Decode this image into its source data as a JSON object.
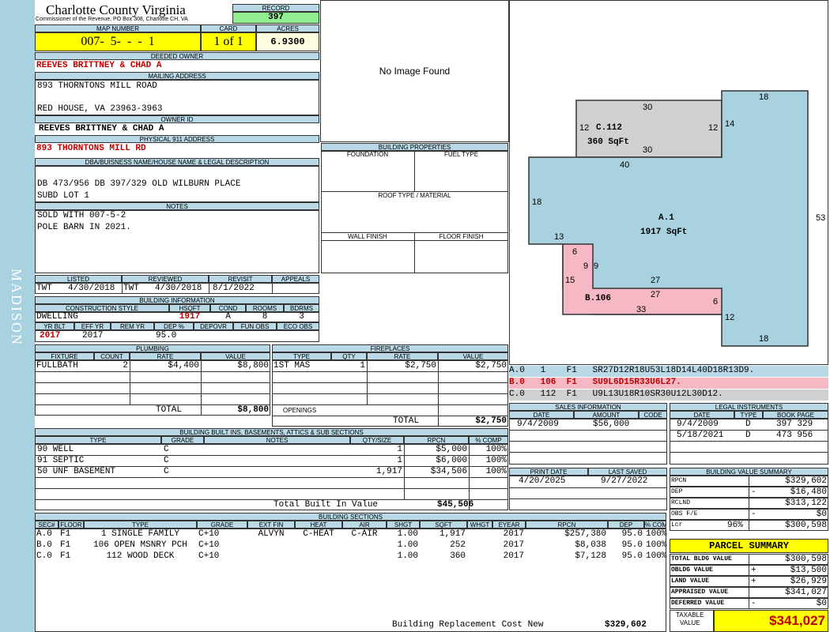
{
  "sidebar_label": "MADISON",
  "header": {
    "county": "Charlotte County Virginia",
    "subtitle": "Commissioner of the Revenue, PO Box 308, Charlotte CH, VA",
    "record_label": "RECORD",
    "record": "397",
    "map_label": "MAP NUMBER",
    "map_number": "007-  5-  -  -  1",
    "card_label": "CARD",
    "card": "1 of 1",
    "acres_label": "ACRES",
    "acres": "6.9300"
  },
  "owner": {
    "deeded_label": "DEEDED OWNER",
    "deeded": "REEVES BRITTNEY & CHAD A",
    "mailing_label": "MAILING ADDRESS",
    "mail1": "893 THORNTONS MILL ROAD",
    "mail2": "RED HOUSE, VA 23963-3963",
    "owner_id_label": "OWNER ID",
    "owner_id": "REEVES BRITTNEY & CHAD A",
    "phys_label": "PHYSICAL 911 ADDRESS",
    "phys": "893 THORNTONS MILL RD"
  },
  "legal": {
    "label": "DBA/BUISNESS NAME/HOUSE NAME & LEGAL DESCRIPTION",
    "line1": "DB 473/956 DB 397/329 OLD WILBURN PLACE",
    "line2": "SUBD LOT 1",
    "notes_label": "NOTES",
    "note1": "SOLD WITH 007-5-2",
    "note2": "POLE BARN IN 2021."
  },
  "image_text": "No Image Found",
  "building_properties": {
    "title": "BUILDING PROPERTIES",
    "foundation": "FOUNDATION",
    "fuel": "FUEL TYPE",
    "roof": "ROOF TYPE / MATERIAL",
    "wall": "WALL FINISH",
    "floor": "FLOOR FINISH"
  },
  "review": {
    "listed_label": "LISTED",
    "reviewed_label": "REVIEWED",
    "revisit_label": "REVISIT",
    "appeals_label": "APPEALS",
    "listed_by": "TWT",
    "listed": "4/30/2018",
    "reviewed_by": "TWT",
    "reviewed": "4/30/2018",
    "revisit": "8/1/2022"
  },
  "building_info": {
    "title": "BUILDING INFORMATION",
    "cs_label": "CONSTRUCTION STYLE",
    "hsqft_label": "HSQFT",
    "cond_label": "COND",
    "rooms_label": "ROOMS",
    "bdrms_label": "BDRMS",
    "cs": "DWELLING",
    "hsqft": "1917",
    "cond": "A",
    "rooms": "8",
    "bdrms": "3",
    "yrblt_label": "YR BLT",
    "effyr_label": "EFF YR",
    "remyr_label": "REM YR",
    "dep_label": "DEP %",
    "depovr_label": "DEPOVR",
    "funobs_label": "FUN OBS",
    "ecoobs_label": "ECO OBS",
    "yrblt": "2017",
    "effyr": "2017",
    "dep": "95.0"
  },
  "plumbing": {
    "title": "PLUMBING",
    "h_fixture": "FIXTURE",
    "h_count": "COUNT",
    "h_rate": "RATE",
    "h_value": "VALUE",
    "fixture": "FULLBATH",
    "count": "2",
    "rate": "$4,400",
    "value": "$8,800",
    "total_label": "TOTAL",
    "total": "$8,800"
  },
  "fireplaces": {
    "title": "FIREPLACES",
    "h_type": "TYPE",
    "h_qty": "QTY",
    "h_rate": "RATE",
    "h_value": "VALUE",
    "type": "1ST MAS",
    "qty": "1",
    "rate": "$2,750",
    "value": "$2,750",
    "openings": "OPENINGS",
    "total_label": "TOTAL",
    "total": "$2,750"
  },
  "built_ins": {
    "title": "BUILDING BUILT INS, BASEMENTS, ATTICS & SUB SECTIONS",
    "h_type": "TYPE",
    "h_grade": "GRADE",
    "h_notes": "NOTES",
    "h_qty": "QTY/SIZE",
    "h_rpcn": "RPCN",
    "h_comp": "% COMP",
    "rows": [
      {
        "type": "90 WELL",
        "grade": "C",
        "qty": "1",
        "rpcn": "$5,000",
        "comp": "100%"
      },
      {
        "type": "91 SEPTIC",
        "grade": "C",
        "qty": "1",
        "rpcn": "$6,000",
        "comp": "100%"
      },
      {
        "type": "50 UNF BASEMENT",
        "grade": "C",
        "qty": "1,917",
        "rpcn": "$34,506",
        "comp": "100%"
      }
    ],
    "total_label": "Total Built In Value",
    "total": "$45,506"
  },
  "sections": {
    "title": "BUILDING SECTIONS",
    "h": [
      "SEC#",
      "FLOOR",
      "TYPE",
      "GRADE",
      "EXT FIN",
      "HEAT",
      "AIR",
      "SHGT",
      "SQFT",
      "WHGT",
      "EYEAR",
      "RPCN",
      "DEP",
      "% COMP"
    ],
    "rows": [
      {
        "sec": "A.0",
        "floor": "F1",
        "type": "1 SINGLE FAMILY",
        "grade": "C+10",
        "ext": "ALVYN",
        "heat": "C-HEAT",
        "air": "C-AIR",
        "shgt": "1.00",
        "sqft": "1,917",
        "eyear": "2017",
        "rpcn": "$257,380",
        "dep": "95.0",
        "comp": "100%"
      },
      {
        "sec": "B.0",
        "floor": "F1",
        "type": "106 OPEN MSNRY PCH",
        "grade": "C+10",
        "ext": "",
        "heat": "",
        "air": "",
        "shgt": "1.00",
        "sqft": "252",
        "eyear": "2017",
        "rpcn": "$8,038",
        "dep": "95.0",
        "comp": "100%"
      },
      {
        "sec": "C.0",
        "floor": "F1",
        "type": "112 WOOD DECK",
        "grade": "C+10",
        "ext": "",
        "heat": "",
        "air": "",
        "shgt": "1.00",
        "sqft": "360",
        "eyear": "2017",
        "rpcn": "$7,128",
        "dep": "95.0",
        "comp": "100%"
      }
    ],
    "total_label": "Building Replacement Cost New",
    "total": "$329,602"
  },
  "sketch": {
    "c_label": "C.112",
    "c_area": "360 SqFt",
    "a_label": "A.1",
    "a_area": "1917 SqFt",
    "b_label": "B.106",
    "b_area": "",
    "dims": {
      "c_top": "30",
      "c_left": "12",
      "c_right": "12",
      "c_bottom": "30",
      "a_top": "18",
      "a_14": "14",
      "a_40": "40",
      "a_18l": "18",
      "a_53": "53",
      "a_13": "13",
      "a_18b": "18",
      "a_12": "12",
      "b_6a": "6",
      "b_9a": "9",
      "b_9b": "9",
      "b_15": "15",
      "b_27a": "27",
      "b_27b": "27",
      "b_6b": "6",
      "b_33": "33"
    }
  },
  "vectors": [
    {
      "text": "A.0   1    F1   SR27D12R18U53L18D14L40D18R13D9.",
      "color": "#b9d9e6"
    },
    {
      "text": "B.0   106  F1   SU9L6D15R33U6L27.",
      "color": "#f5b8c4"
    },
    {
      "text": "C.0   112  F1   U9L13U18R10SR30U12L30D12.",
      "color": "#d0d0d0"
    }
  ],
  "sales": {
    "title": "SALES INFORMATION",
    "h_date": "DATE",
    "h_amount": "AMOUNT",
    "h_code": "CODE",
    "date": "9/4/2009",
    "amount": "$56,000"
  },
  "legal_instr": {
    "title": "LEGAL INSTRUMENTS",
    "h_date": "DATE",
    "h_type": "TYPE",
    "h_book": "BOOK PAGE",
    "rows": [
      {
        "date": "9/4/2009",
        "type": "D",
        "book": "397 329"
      },
      {
        "date": "5/18/2021",
        "type": "D",
        "book": "473 956"
      }
    ]
  },
  "print": {
    "print_label": "PRINT DATE",
    "saved_label": "LAST SAVED",
    "print": "4/20/2025",
    "saved": "9/27/2022"
  },
  "value_summary": {
    "title": "BUILDING VALUE SUMMARY",
    "rows": [
      {
        "label": "RPCN",
        "sign": "",
        "val": "$329,602"
      },
      {
        "label": "DEP",
        "sign": "-",
        "val": "$16,480"
      },
      {
        "label": "RCLND",
        "sign": "",
        "val": "$313,122"
      },
      {
        "label": "OBS F/E",
        "sign": "-",
        "val": "$0"
      },
      {
        "label": "Lcr",
        "pct": "96%",
        "sign": "",
        "val": "$300,598"
      }
    ]
  },
  "parcel": {
    "title": "PARCEL SUMMARY",
    "rows": [
      {
        "label": "TOTAL BLDG VALUE",
        "sign": "",
        "val": "$300,598"
      },
      {
        "label": "OBLDG VALUE",
        "sign": "+",
        "val": "$13,500"
      },
      {
        "label": "LAND VALUE",
        "sign": "+",
        "val": "$26,929"
      },
      {
        "label": "APPRAISED VALUE",
        "sign": "",
        "val": "$341,027"
      },
      {
        "label": "DEFERRED VALUE",
        "sign": "-",
        "val": "$0"
      }
    ],
    "taxable_label1": "TAXABLE",
    "taxable_label2": "VALUE",
    "taxable": "$341,027"
  },
  "colors": {
    "header": "#b9d9e6",
    "red": "#c00000",
    "yellow": "#ffff00",
    "green": "#90ee90",
    "sketchA": "#a9d2e0",
    "sketchB": "#f5b8c4",
    "sketchC": "#d0d0d0"
  }
}
